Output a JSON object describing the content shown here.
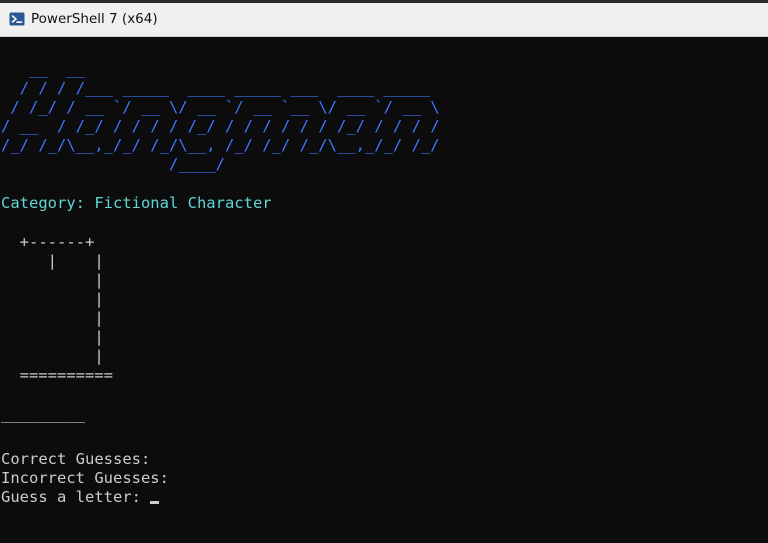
{
  "window": {
    "title": "PowerShell 7 (x64)"
  },
  "terminal": {
    "banner_lines": [
      "   __  __",
      "  / / / /___ _____  ____ _____ ___  ____ _____",
      " / /_/ / __ `/ __ \\/ __ `/ __ `__ \\/ __ `/ __ \\",
      "/ __  / /_/ / / / / /_/ / / / / / / /_/ / / / /",
      "/_/ /_/\\__,_/_/ /_/\\__, /_/ /_/ /_/\\__,_/_/ /_/",
      "                  /____/"
    ],
    "category_line": "Category: Fictional Character",
    "gallows_lines": [
      "  +------+",
      "     |    |",
      "          |",
      "          |",
      "          |",
      "          |",
      "          |",
      "  =========="
    ],
    "word_line": "_________",
    "correct_line": "Correct Guesses:",
    "incorrect_line": "Incorrect Guesses:",
    "prompt_line": "Guess a letter: "
  },
  "colors": {
    "background": "#0c0c0c",
    "titlebar": "#f0f0f0",
    "banner": "#3b78ff",
    "category": "#61d6d6",
    "text": "#cccccc"
  },
  "icons": {
    "app": "powershell-icon"
  }
}
